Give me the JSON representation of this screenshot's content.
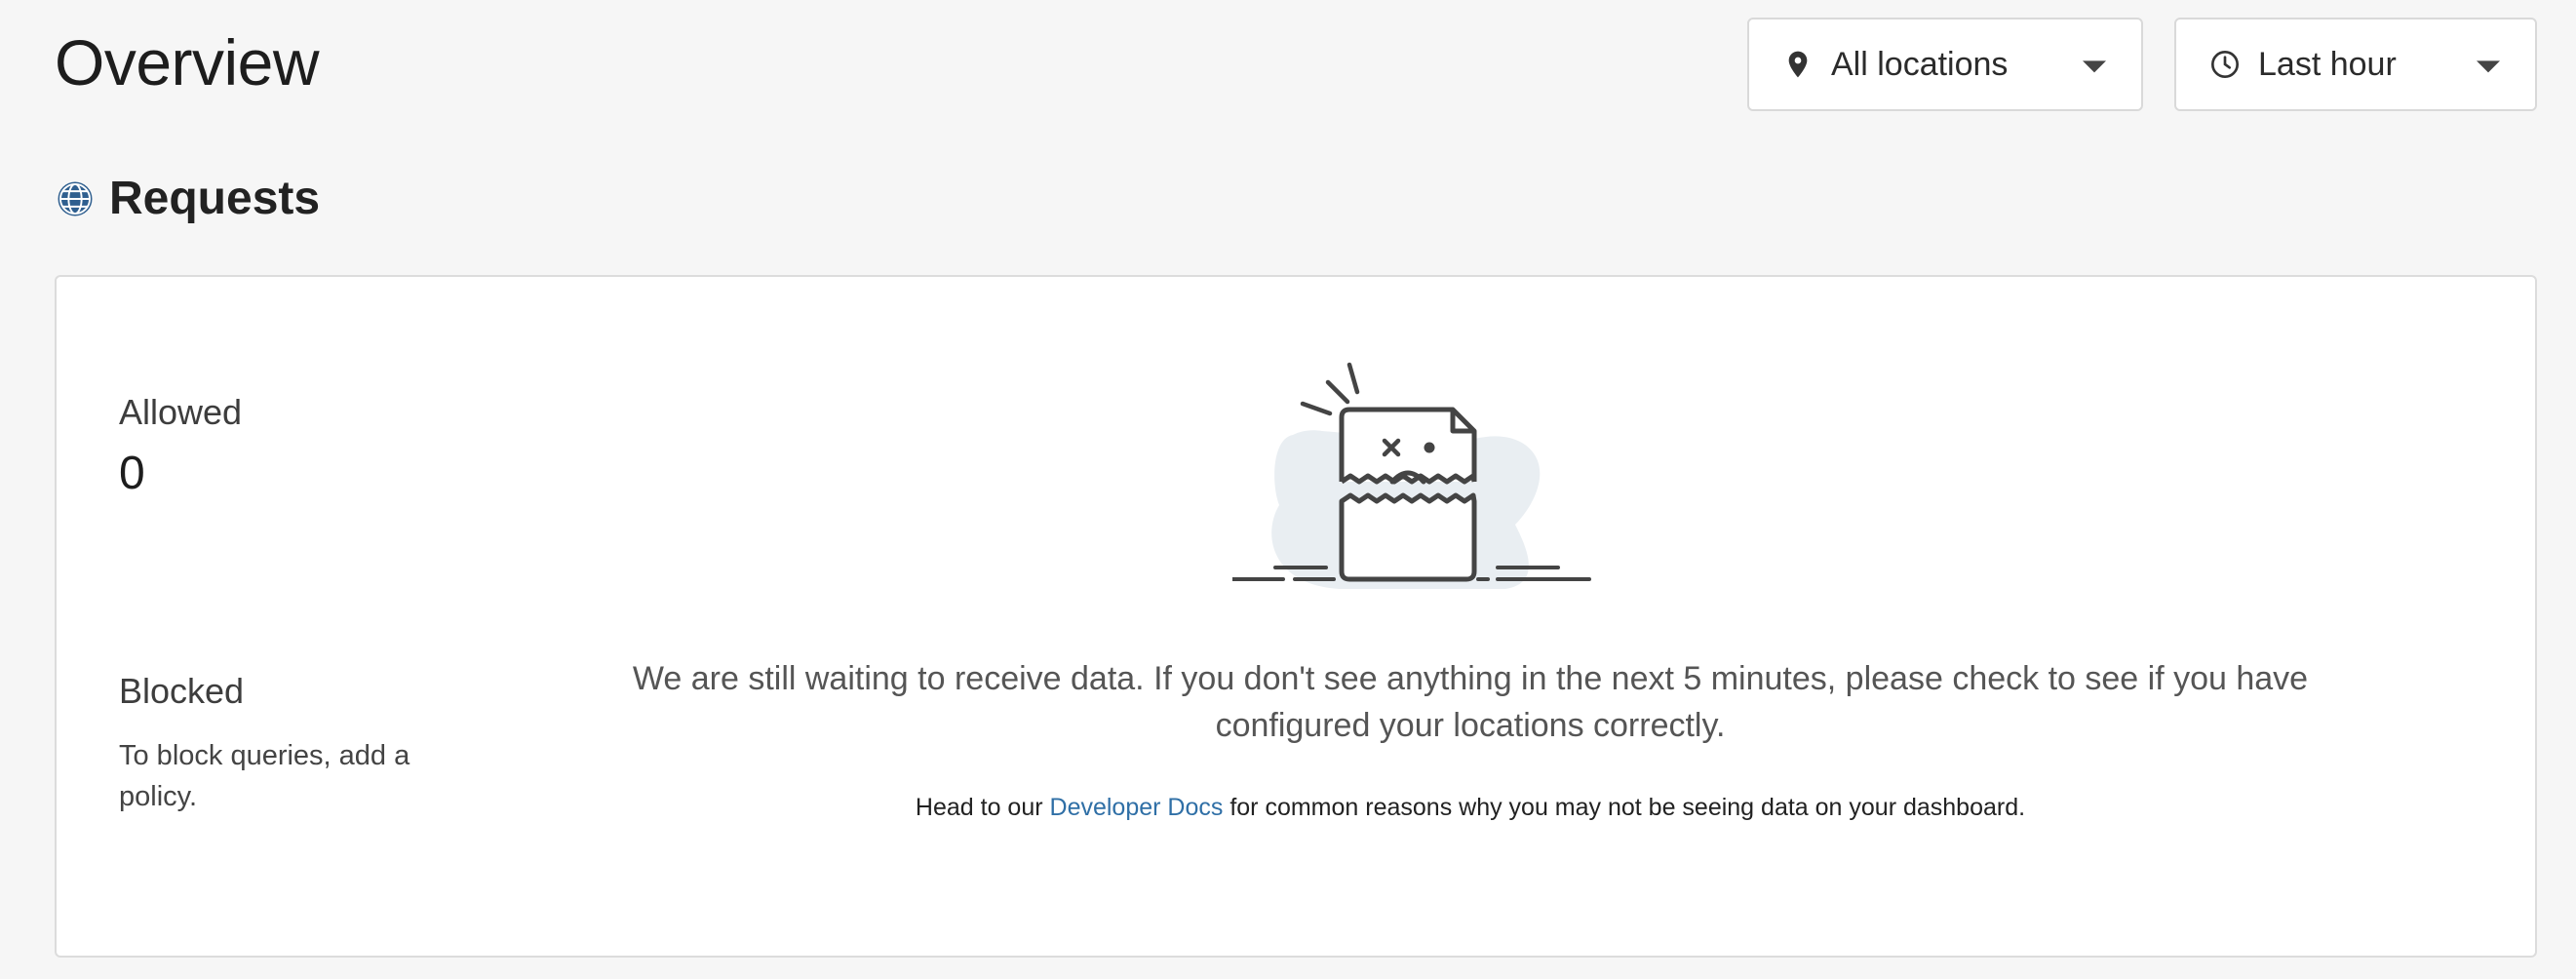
{
  "header": {
    "title": "Overview",
    "location_filter": {
      "label": "All locations",
      "icon": "map-pin-icon"
    },
    "time_filter": {
      "label": "Last hour",
      "icon": "clock-icon"
    }
  },
  "requests": {
    "title": "Requests",
    "icon": "globe-icon",
    "allowed": {
      "label": "Allowed",
      "value": "0"
    },
    "blocked": {
      "label": "Blocked",
      "hint": "To block queries, add a policy."
    },
    "empty_state": {
      "illustration": "broken-document-icon",
      "message": "We are still waiting to receive data. If you don't see anything in the next 5 minutes, please check to see if you have configured your locations correctly.",
      "docs_prefix": "Head to our ",
      "docs_link": "Developer Docs",
      "docs_suffix": " for common reasons why you may not be seeing data on your dashboard."
    }
  },
  "colors": {
    "background": "#f6f6f6",
    "card": "#ffffff",
    "link": "#2f6fa6",
    "globe_icon": "#2f5f8f"
  }
}
